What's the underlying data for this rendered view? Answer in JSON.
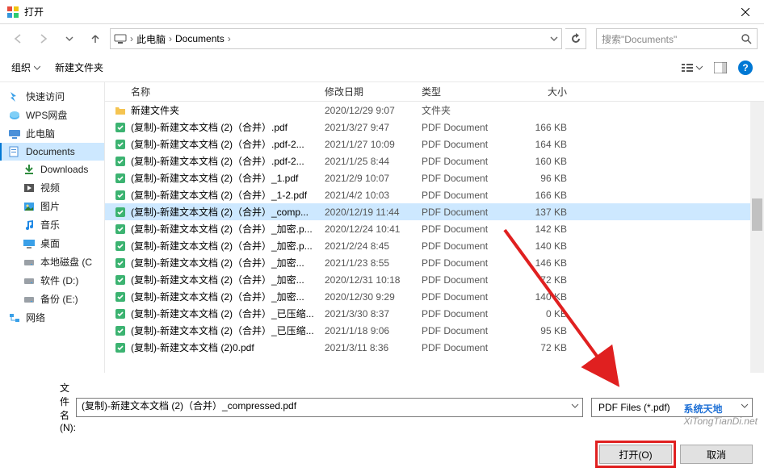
{
  "window": {
    "title": "打开"
  },
  "nav": {
    "crumbs": [
      "此电脑",
      "Documents"
    ],
    "search_placeholder": "搜索\"Documents\""
  },
  "toolbar": {
    "organize": "组织",
    "new_folder": "新建文件夹"
  },
  "sidebar": {
    "items": [
      {
        "icon": "quick",
        "label": "快速访问"
      },
      {
        "icon": "wps",
        "label": "WPS网盘"
      },
      {
        "icon": "pc",
        "label": "此电脑"
      },
      {
        "icon": "doc",
        "label": "Documents",
        "indent": true,
        "active": true
      },
      {
        "icon": "dl",
        "label": "Downloads",
        "indent": true
      },
      {
        "icon": "video",
        "label": "视频",
        "indent": true
      },
      {
        "icon": "pic",
        "label": "图片",
        "indent": true
      },
      {
        "icon": "music",
        "label": "音乐",
        "indent": true
      },
      {
        "icon": "desktop",
        "label": "桌面",
        "indent": true
      },
      {
        "icon": "disk",
        "label": "本地磁盘 (C",
        "indent": true
      },
      {
        "icon": "disk",
        "label": "软件 (D:)",
        "indent": true
      },
      {
        "icon": "disk",
        "label": "备份 (E:)",
        "indent": true
      },
      {
        "icon": "net",
        "label": "网络"
      }
    ]
  },
  "columns": {
    "name": "名称",
    "date": "修改日期",
    "type": "类型",
    "size": "大小"
  },
  "files": [
    {
      "icon": "folder",
      "name": "新建文件夹",
      "date": "2020/12/29 9:07",
      "type": "文件夹",
      "size": ""
    },
    {
      "icon": "pdf",
      "name": "(复制)-新建文本文档 (2)（合并）.pdf",
      "date": "2021/3/27 9:47",
      "type": "PDF Document",
      "size": "166 KB"
    },
    {
      "icon": "pdf",
      "name": "(复制)-新建文本文档 (2)（合并）.pdf-2...",
      "date": "2021/1/27 10:09",
      "type": "PDF Document",
      "size": "164 KB"
    },
    {
      "icon": "pdf",
      "name": "(复制)-新建文本文档 (2)（合并）.pdf-2...",
      "date": "2021/1/25 8:44",
      "type": "PDF Document",
      "size": "160 KB"
    },
    {
      "icon": "pdf",
      "name": "(复制)-新建文本文档 (2)（合并）_1.pdf",
      "date": "2021/2/9 10:07",
      "type": "PDF Document",
      "size": "96 KB"
    },
    {
      "icon": "pdf",
      "name": "(复制)-新建文本文档 (2)（合并）_1-2.pdf",
      "date": "2021/4/2 10:03",
      "type": "PDF Document",
      "size": "166 KB"
    },
    {
      "icon": "pdf",
      "name": "(复制)-新建文本文档 (2)（合并）_comp...",
      "date": "2020/12/19 11:44",
      "type": "PDF Document",
      "size": "137 KB",
      "selected": true
    },
    {
      "icon": "pdf",
      "name": "(复制)-新建文本文档 (2)（合并）_加密.p...",
      "date": "2020/12/24 10:41",
      "type": "PDF Document",
      "size": "142 KB"
    },
    {
      "icon": "pdf",
      "name": "(复制)-新建文本文档 (2)（合并）_加密.p...",
      "date": "2021/2/24 8:45",
      "type": "PDF Document",
      "size": "140 KB"
    },
    {
      "icon": "pdf",
      "name": "(复制)-新建文本文档 (2)（合并）_加密...",
      "date": "2021/1/23 8:55",
      "type": "PDF Document",
      "size": "146 KB"
    },
    {
      "icon": "pdf",
      "name": "(复制)-新建文本文档 (2)（合并）_加密...",
      "date": "2020/12/31 10:18",
      "type": "PDF Document",
      "size": "72 KB"
    },
    {
      "icon": "pdf",
      "name": "(复制)-新建文本文档 (2)（合并）_加密...",
      "date": "2020/12/30 9:29",
      "type": "PDF Document",
      "size": "140 KB"
    },
    {
      "icon": "pdf",
      "name": "(复制)-新建文本文档 (2)（合并）_已压缩...",
      "date": "2021/3/30 8:37",
      "type": "PDF Document",
      "size": "0 KB"
    },
    {
      "icon": "pdf",
      "name": "(复制)-新建文本文档 (2)（合并）_已压缩...",
      "date": "2021/1/18 9:06",
      "type": "PDF Document",
      "size": "95 KB"
    },
    {
      "icon": "pdf",
      "name": "(复制)-新建文本文档 (2)0.pdf",
      "date": "2021/3/11 8:36",
      "type": "PDF Document",
      "size": "72 KB"
    }
  ],
  "footer": {
    "filename_label": "文件名(N):",
    "filename_value": "(复制)-新建文本文档 (2)（合并）_compressed.pdf",
    "filter": "PDF Files (*.pdf)",
    "open": "打开(O)",
    "cancel": "取消"
  },
  "watermark": {
    "brand": "系统天地",
    "url": "XiTongTianDi.net"
  }
}
